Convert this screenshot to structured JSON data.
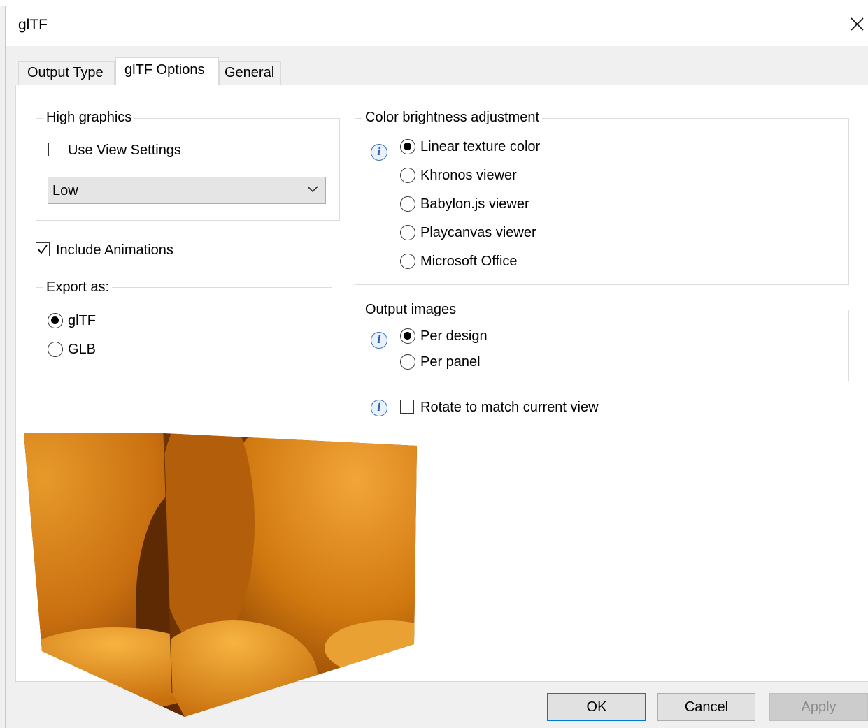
{
  "window": {
    "title": "glTF"
  },
  "tabs": [
    {
      "label": "Output Type"
    },
    {
      "label": "glTF Options"
    },
    {
      "label": "General"
    }
  ],
  "high_graphics": {
    "legend": "High graphics",
    "use_view_settings": {
      "label": "Use View Settings",
      "checked": false
    },
    "quality": {
      "value": "Low"
    }
  },
  "include_animations": {
    "label": "Include Animations",
    "checked": true
  },
  "export_as": {
    "legend": "Export as:",
    "options": [
      {
        "label": "glTF",
        "selected": true
      },
      {
        "label": "GLB",
        "selected": false
      }
    ]
  },
  "color_brightness": {
    "legend": "Color brightness adjustment",
    "options": [
      {
        "label": "Linear texture color",
        "selected": true
      },
      {
        "label": "Khronos viewer",
        "selected": false
      },
      {
        "label": "Babylon.js viewer",
        "selected": false
      },
      {
        "label": "Playcanvas viewer",
        "selected": false
      },
      {
        "label": "Microsoft Office",
        "selected": false
      }
    ]
  },
  "output_images": {
    "legend": "Output images",
    "options": [
      {
        "label": "Per design",
        "selected": true
      },
      {
        "label": "Per panel",
        "selected": false
      }
    ]
  },
  "rotate_to_match": {
    "label": "Rotate to match current view",
    "checked": false
  },
  "buttons": {
    "ok": "OK",
    "cancel": "Cancel",
    "apply": "Apply"
  },
  "icons": {
    "info": "info-icon",
    "close": "close-icon",
    "dropdown": "chevron-down-icon"
  },
  "colors": {
    "accent": "#0078d7",
    "info": "#3b6fb8",
    "dialog_bg": "#f0f0f0",
    "panel_bg": "#ffffff"
  }
}
